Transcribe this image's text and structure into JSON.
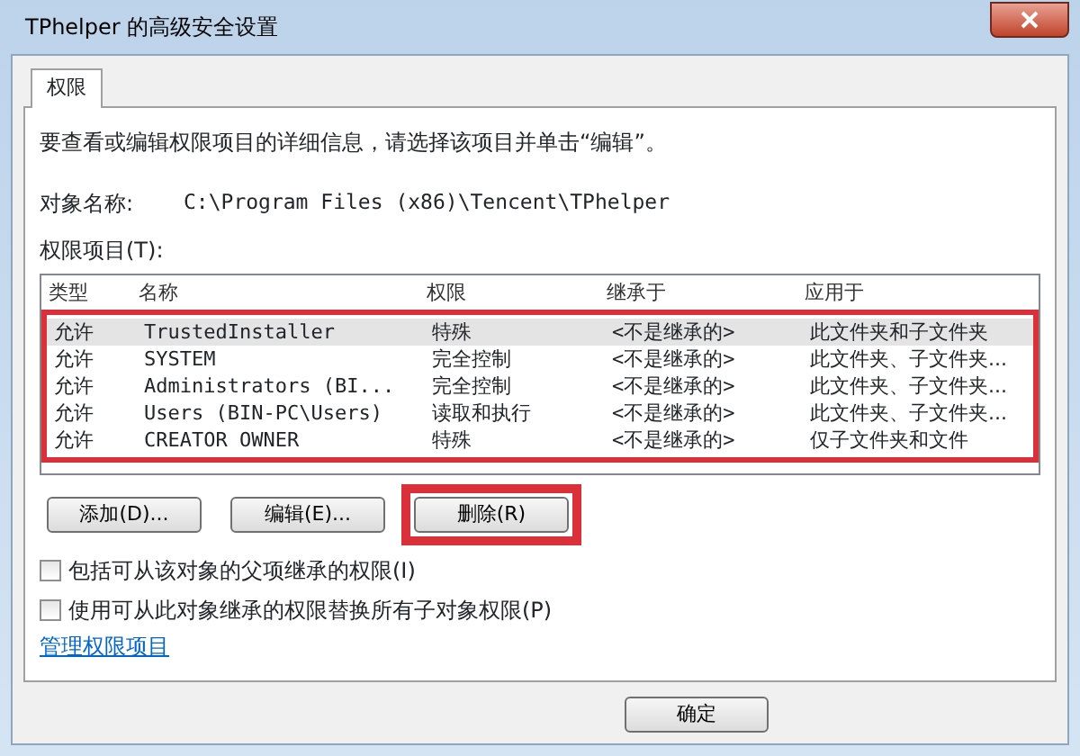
{
  "window": {
    "title": "TPhelper 的高级安全设置"
  },
  "tabs": [
    {
      "label": "权限",
      "selected": true
    }
  ],
  "instruction": "要查看或编辑权限项目的详细信息，请选择该项目并单击“编辑”。",
  "object_name": {
    "label": "对象名称:",
    "value": "C:\\Program Files (x86)\\Tencent\\TPhelper"
  },
  "list_label": "权限项目(T):",
  "table": {
    "columns": [
      "类型",
      "名称",
      "权限",
      "继承于",
      "应用于"
    ],
    "highlighted": true,
    "rows": [
      {
        "cells": [
          "允许",
          "TrustedInstaller",
          "特殊",
          "<不是继承的>",
          "此文件夹和子文件夹"
        ],
        "selected": true
      },
      {
        "cells": [
          "允许",
          "SYSTEM",
          "完全控制",
          "<不是继承的>",
          "此文件夹、子文件夹..."
        ],
        "selected": false
      },
      {
        "cells": [
          "允许",
          "Administrators (BI...",
          "完全控制",
          "<不是继承的>",
          "此文件夹、子文件夹..."
        ],
        "selected": false
      },
      {
        "cells": [
          "允许",
          "Users (BIN-PC\\Users)",
          "读取和执行",
          "<不是继承的>",
          "此文件夹、子文件夹..."
        ],
        "selected": false
      },
      {
        "cells": [
          "允许",
          "CREATOR OWNER",
          "特殊",
          "<不是继承的>",
          "仅子文件夹和文件"
        ],
        "selected": false
      }
    ]
  },
  "buttons": [
    {
      "label": "添加(D)...",
      "highlighted": false
    },
    {
      "label": "编辑(E)...",
      "highlighted": false
    },
    {
      "label": "删除(R)",
      "highlighted": true
    }
  ],
  "checkboxes": [
    {
      "label": "包括可从该对象的父项继承的权限(I)",
      "checked": false
    },
    {
      "label": "使用可从此对象继承的权限替换所有子对象权限(P)",
      "checked": false
    }
  ],
  "link": "管理权限项目",
  "ok_button": "确定"
}
